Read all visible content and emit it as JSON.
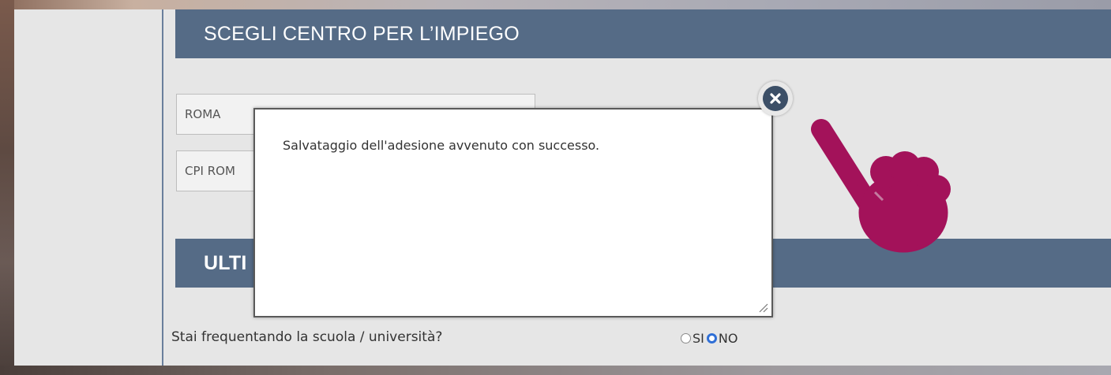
{
  "sections": {
    "center_header": "SCEGLI CENTRO PER L’IMPIEGO",
    "second_header": "ULTI"
  },
  "selects": {
    "region_value": "ROMA",
    "center_value": "CPI ROM"
  },
  "modal": {
    "message": "Salvataggio dell'adesione avvenuto con successo.",
    "close_icon": "close-icon"
  },
  "question": {
    "text": "Stai frequentando la scuola / università?",
    "options": [
      {
        "label": "SI",
        "checked": false
      },
      {
        "label": "NO",
        "checked": true
      }
    ]
  },
  "overlay": {
    "pointer_icon": "hand-pointer-icon",
    "pointer_color": "#a3125a"
  },
  "colors": {
    "header_bg": "#556b86",
    "radio_checked": "#2f6fd6"
  }
}
